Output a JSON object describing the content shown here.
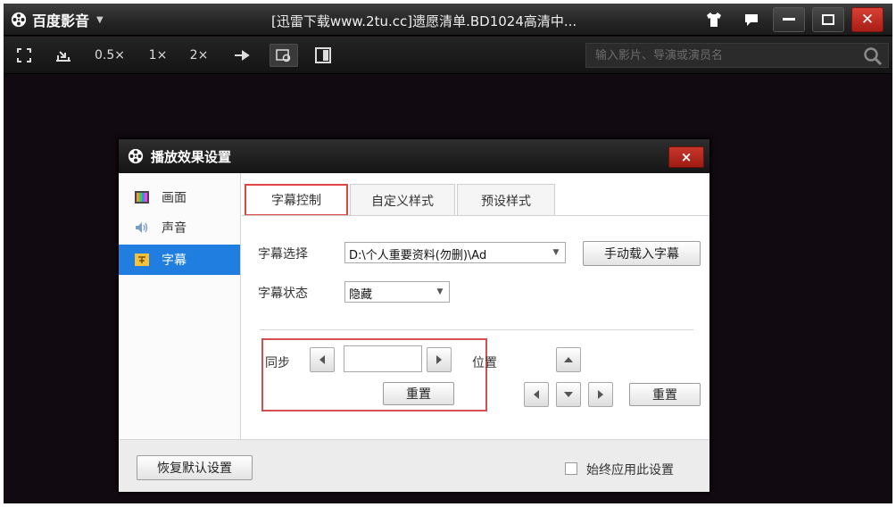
{
  "app": {
    "name": "百度影音",
    "window_title": "[迅雷下载www.2tu.cc]遗愿清单.BD1024高清中..."
  },
  "toolbar": {
    "speed_05": "0.5×",
    "speed_1": "1×",
    "speed_2": "2×"
  },
  "search": {
    "placeholder": "输入影片、导演或演员名"
  },
  "dialog": {
    "title": "播放效果设置",
    "close_label": "×",
    "sidebar": [
      {
        "label": "画面"
      },
      {
        "label": "声音"
      },
      {
        "label": "字幕"
      }
    ],
    "tabs": [
      {
        "label": "字幕控制"
      },
      {
        "label": "自定义样式"
      },
      {
        "label": "预设样式"
      }
    ],
    "subtitle_select": {
      "label": "字幕选择",
      "value": "D:\\个人重要资料(勿删)\\Ad"
    },
    "manual_load_label": "手动载入字幕",
    "subtitle_state": {
      "label": "字幕状态",
      "value": "隐藏"
    },
    "sync": {
      "label": "同步",
      "value": "",
      "reset_label": "重置"
    },
    "position": {
      "label": "位置",
      "reset_label": "重置"
    },
    "restore_defaults_label": "恢复默认设置",
    "always_apply_label": "始终应用此设置",
    "always_apply_checked": false
  },
  "colors": {
    "video_bg": "#120a11",
    "selected": "#1f7ee0",
    "close_red": "#c8372c",
    "highlight": "#d45050"
  }
}
